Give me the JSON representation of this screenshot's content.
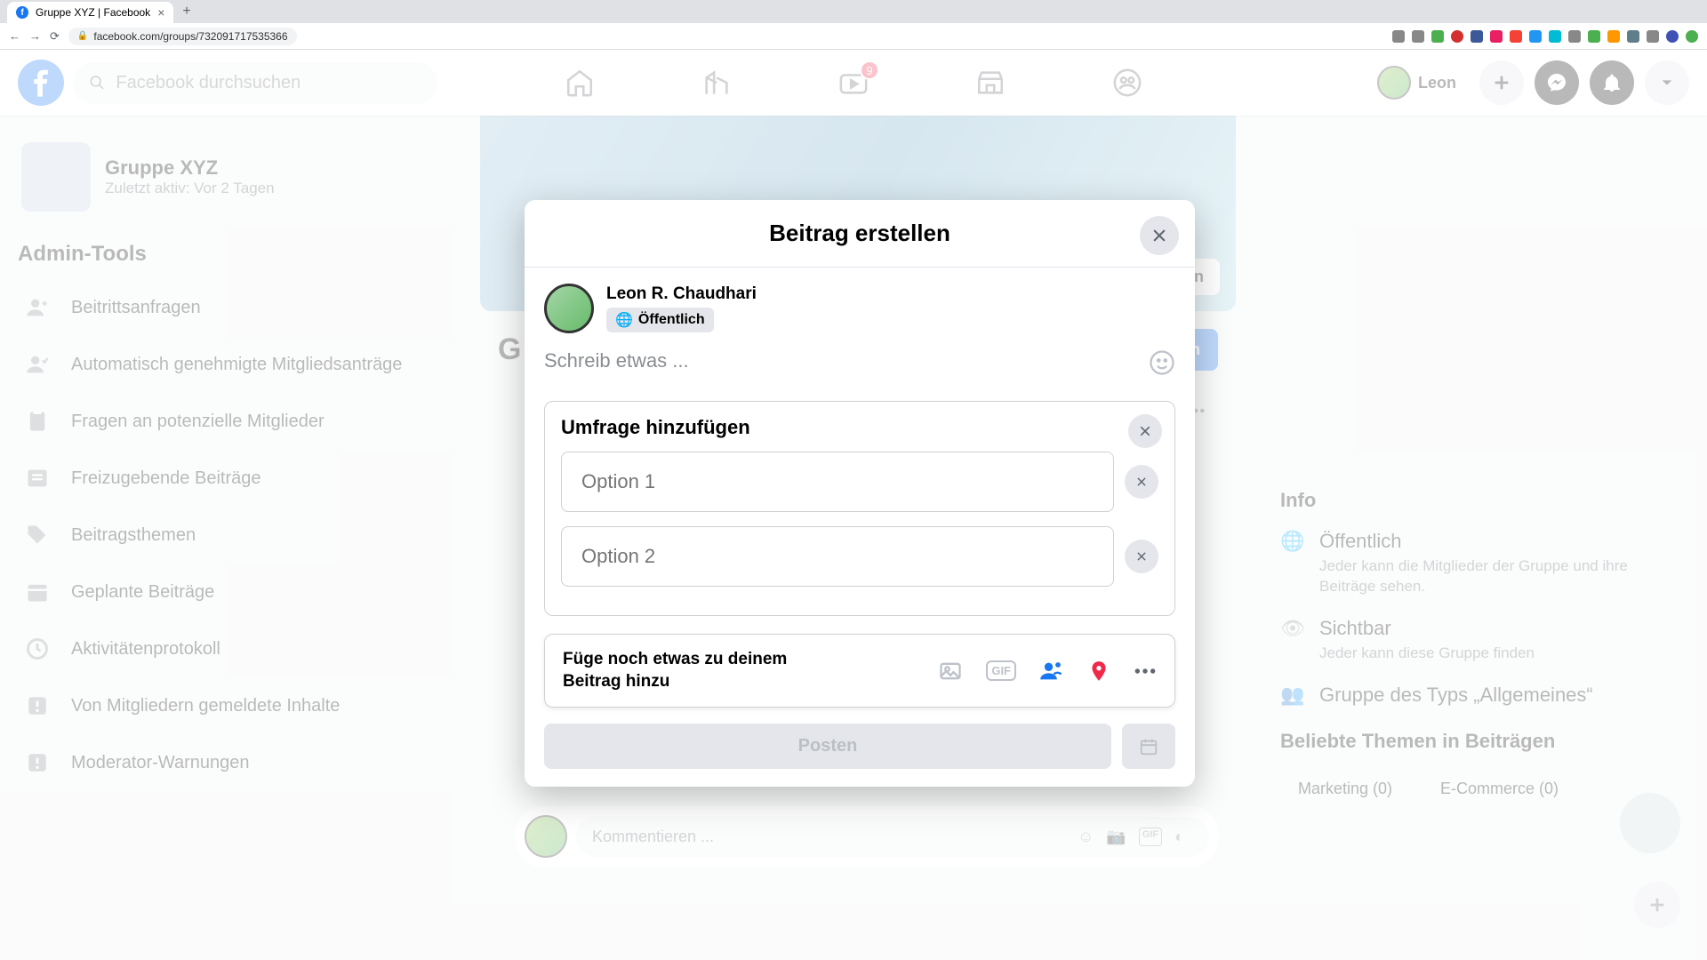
{
  "browser": {
    "tab_title": "Gruppe XYZ | Facebook",
    "url": "facebook.com/groups/732091717535366"
  },
  "header": {
    "search_placeholder": "Facebook durchsuchen",
    "watch_badge": "9",
    "profile_first_name": "Leon"
  },
  "left": {
    "group_name": "Gruppe XYZ",
    "group_subtitle": "Zuletzt aktiv: Vor 2 Tagen",
    "admin_heading": "Admin-Tools",
    "items": [
      "Beitrittsanfragen",
      "Automatisch genehmigte Mitgliedsanträge",
      "Fragen an potenzielle Mitglieder",
      "Freizugebende Beiträge",
      "Beitragsthemen",
      "Geplante Beiträge",
      "Aktivitätenprotokoll",
      "Von Mitgliedern gemeldete Inhalte",
      "Moderator-Warnungen"
    ]
  },
  "cover": {
    "edit_label": "Bearbeiten",
    "invite_label": "Einladen",
    "group_letter": "G"
  },
  "comment": {
    "placeholder": "Kommentieren ..."
  },
  "right": {
    "info_heading": "Info",
    "rows": [
      {
        "title": "Öffentlich",
        "desc": "Jeder kann die Mitglieder der Gruppe und ihre Beiträge sehen."
      },
      {
        "title": "Sichtbar",
        "desc": "Jeder kann diese Gruppe finden"
      },
      {
        "title": "Gruppe des Typs „Allgemeines“",
        "desc": ""
      }
    ],
    "topics_heading": "Beliebte Themen in Beiträgen",
    "topics": [
      "Marketing (0)",
      "E-Commerce (0)"
    ]
  },
  "modal": {
    "title": "Beitrag erstellen",
    "author": "Leon R. Chaudhari",
    "audience": "Öffentlich",
    "post_placeholder": "Schreib etwas ...",
    "poll_title": "Umfrage hinzufügen",
    "option1_placeholder": "Option 1",
    "option2_placeholder": "Option 2",
    "attach_label": "Füge noch etwas zu deinem Beitrag hinzu",
    "post_button": "Posten"
  }
}
